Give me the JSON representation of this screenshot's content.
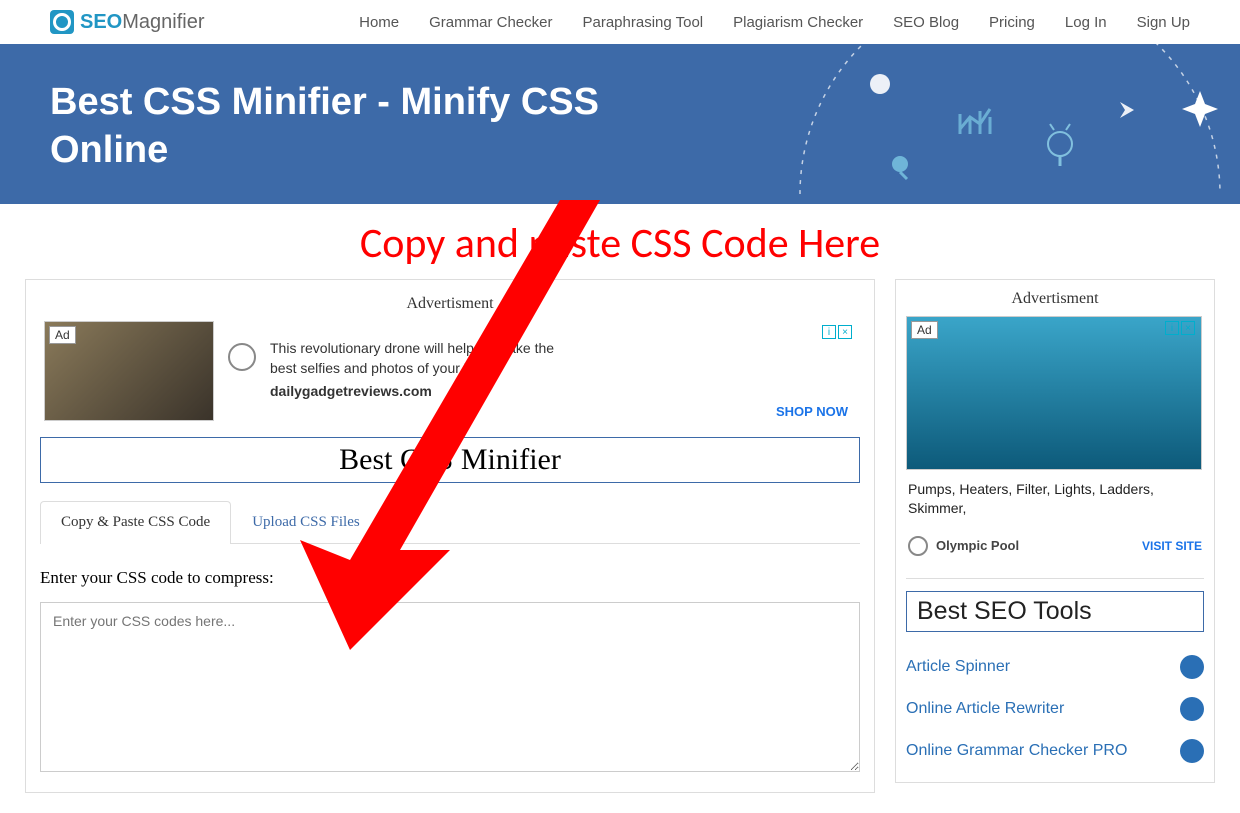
{
  "logo": {
    "part1": "SEO",
    "part2": "Magnifier"
  },
  "nav": [
    "Home",
    "Grammar Checker",
    "Paraphrasing Tool",
    "Plagiarism Checker",
    "SEO Blog",
    "Pricing",
    "Log In",
    "Sign Up"
  ],
  "hero": {
    "title": "Best CSS Minifier - Minify CSS Online"
  },
  "overlay": {
    "text": "Copy and paste CSS Code Here"
  },
  "main": {
    "ad_label": "Advertisment",
    "ad1": {
      "badge": "Ad",
      "line1": "This revolutionary drone will help you take the",
      "line2": "best selfies and photos of your life",
      "domain": "dailygadgetreviews.com",
      "cta": "SHOP NOW"
    },
    "tool_title": "Best CSS Minifier",
    "tabs": {
      "active": "Copy & Paste CSS Code",
      "inactive": "Upload CSS Files"
    },
    "field_label": "Enter your CSS code to compress:",
    "placeholder": "Enter your CSS codes here..."
  },
  "side": {
    "ad_label": "Advertisment",
    "ad2": {
      "badge": "Ad",
      "text": "Pumps, Heaters, Filter, Lights, Ladders, Skimmer,",
      "site": "Olympic Pool",
      "cta": "VISIT SITE"
    },
    "tools_title": "Best SEO Tools",
    "tools": [
      {
        "label": "Article Spinner"
      },
      {
        "label": "Online Article Rewriter"
      },
      {
        "label": "Online Grammar Checker PRO"
      }
    ]
  }
}
